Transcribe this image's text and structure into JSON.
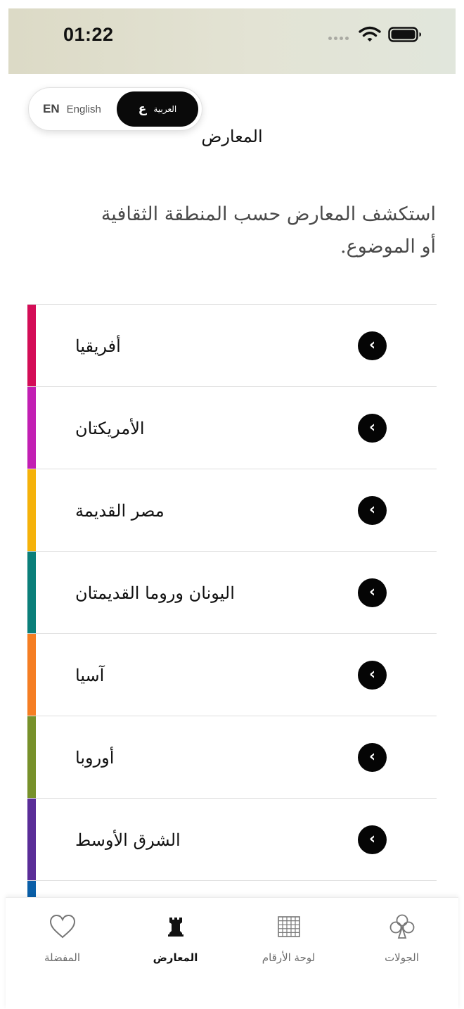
{
  "status_bar": {
    "time": "01:22"
  },
  "language_toggle": {
    "en_code": "EN",
    "en_label": "English",
    "ar_code": "ع",
    "ar_label": "العربية",
    "selected": "ar"
  },
  "page": {
    "title": "المعارض",
    "intro": "استكشف المعارض حسب المنطقة الثقافية أو الموضوع."
  },
  "galleries": [
    {
      "label": "أفريقيا",
      "color": "#d40d57",
      "chevron": "‹"
    },
    {
      "label": "الأمريكتان",
      "color": "#c21fb3",
      "chevron": "‹"
    },
    {
      "label": "مصر القديمة",
      "color": "#f5b20a",
      "chevron": "‹"
    },
    {
      "label": "اليونان وروما القديمتان",
      "color": "#0b7f7a",
      "chevron": "‹"
    },
    {
      "label": "آسيا",
      "color": "#f57e23",
      "chevron": "‹"
    },
    {
      "label": "أوروبا",
      "color": "#77912a",
      "chevron": "‹"
    },
    {
      "label": "الشرق الأوسط",
      "color": "#5a2d98",
      "chevron": "‹"
    }
  ],
  "partial_gallery": {
    "color": "#0a5fa8"
  },
  "tab_bar": {
    "tabs": [
      {
        "label": "المفضلة",
        "icon": "heart-icon",
        "active": false
      },
      {
        "label": "المعارض",
        "icon": "chess-rook-icon",
        "active": true
      },
      {
        "label": "لوحة الأرقام",
        "icon": "keypad-grid-icon",
        "active": false
      },
      {
        "label": "الجولات",
        "icon": "club-icon",
        "active": false
      }
    ]
  }
}
